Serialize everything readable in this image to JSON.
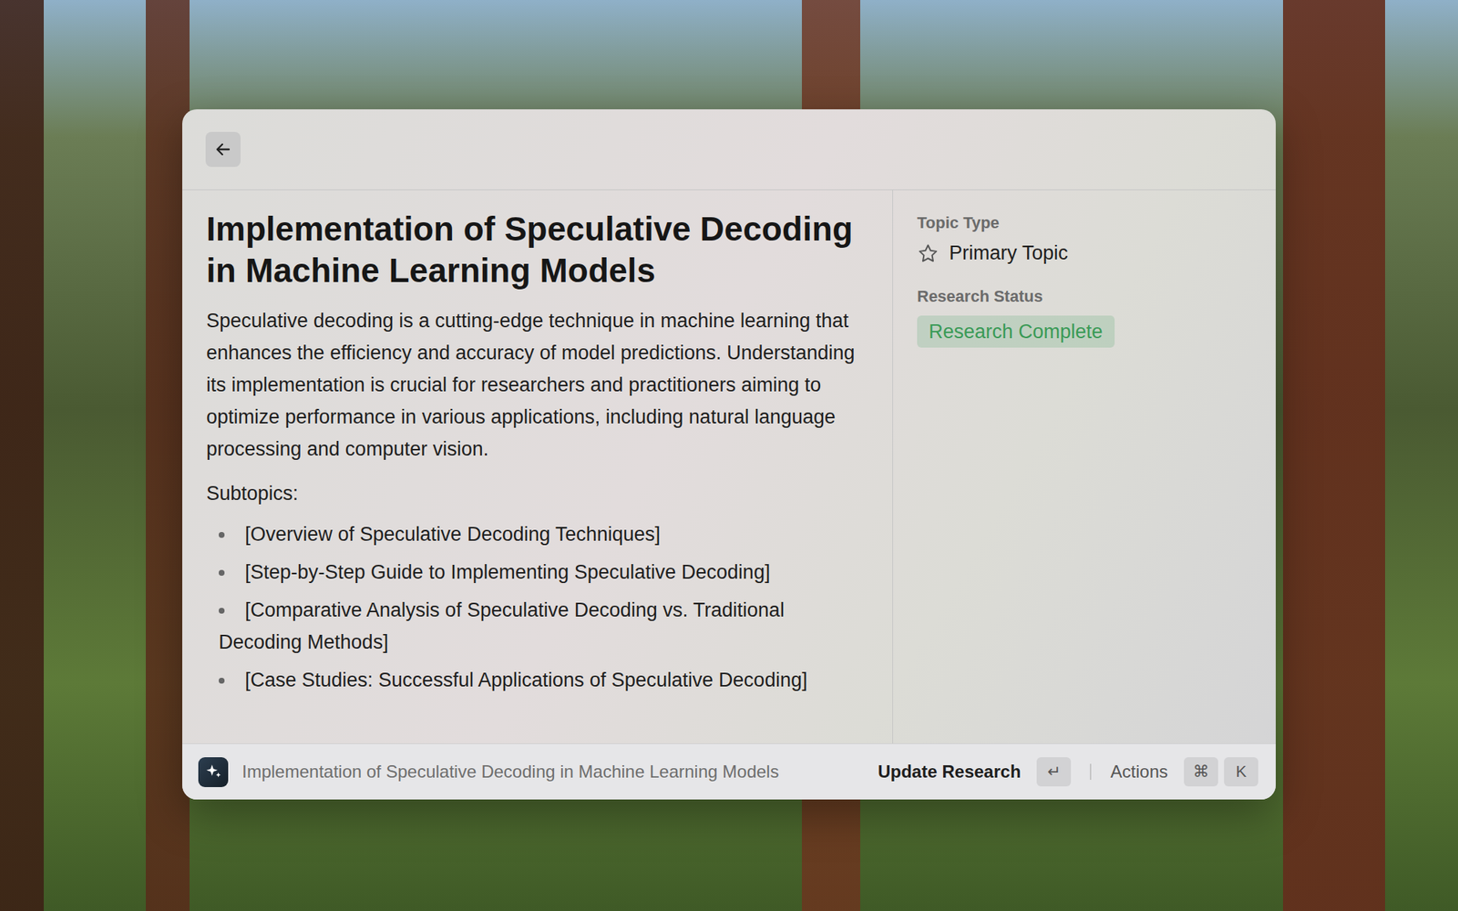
{
  "topic": {
    "title": "Implementation of Speculative Decoding in Machine Learning Models",
    "description": "Speculative decoding is a cutting-edge technique in machine learning that enhances the efficiency and accuracy of model predictions. Understanding its implementation is crucial for researchers and practitioners aiming to optimize performance in various applications, including natural language processing and computer vision.",
    "subtopics_label": "Subtopics:",
    "subtopics": [
      "[Overview of Speculative Decoding Techniques]",
      "[Step-by-Step Guide to Implementing Speculative Decoding]",
      "[Comparative Analysis of Speculative Decoding vs. Traditional Decoding Methods]",
      "[Case Studies: Successful Applications of Speculative Decoding]"
    ]
  },
  "sidebar": {
    "fields": [
      {
        "label": "Topic Type",
        "value": "Primary Topic",
        "kind": "icon-value"
      },
      {
        "label": "Research Status",
        "value": "Research Complete",
        "kind": "badge",
        "color": "#3a9a57"
      }
    ]
  },
  "footer": {
    "query": "Implementation of Speculative Decoding in Machine Learning Models",
    "primary_action": {
      "label": "Update Research",
      "keys": [
        "↵"
      ]
    },
    "secondary_action": {
      "label": "Actions",
      "keys": [
        "⌘",
        "K"
      ]
    }
  }
}
